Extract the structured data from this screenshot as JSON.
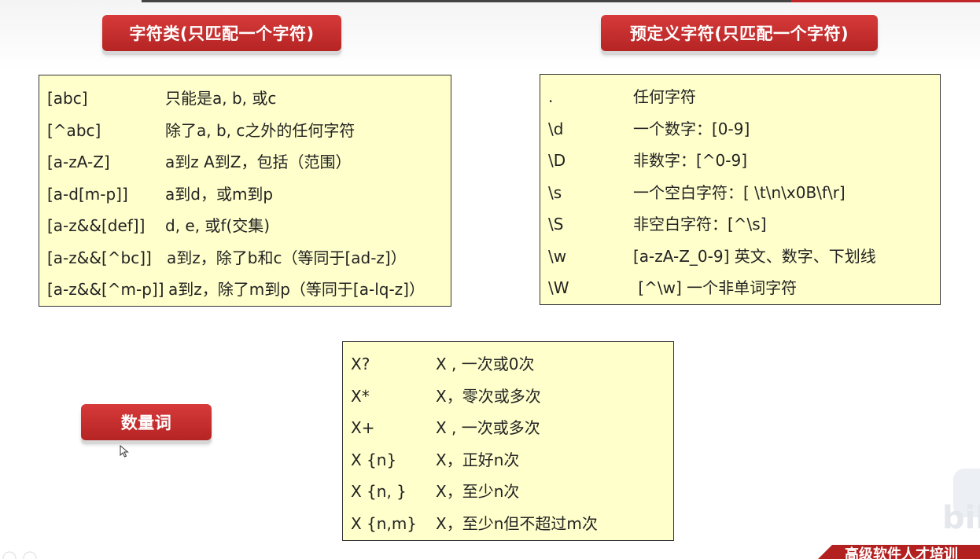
{
  "badges": {
    "char_class": "字符类(只匹配一个字符)",
    "predefined": "预定义字符(只匹配一个字符)",
    "quantifier": "数量词"
  },
  "char_class_rows": [
    {
      "k": "[abc]",
      "v": "只能是a, b, 或c"
    },
    {
      "k": "[^abc]",
      "v": "除了a, b, c之外的任何字符"
    },
    {
      "k": "[a-zA-Z]",
      "v": "a到z A到Z，包括（范围）"
    },
    {
      "k": "[a-d[m-p]]",
      "v": "a到d，或m到p"
    },
    {
      "k": "[a-z&&[def]]",
      "v": "d, e, 或f(交集)"
    },
    {
      "k": "[a-z&&[^bc]]",
      "v": "a到z，除了b和c（等同于[ad-z]）"
    },
    {
      "k": "[a-z&&[^m-p]]",
      "v": "a到z，除了m到p（等同于[a-lq-z]）"
    }
  ],
  "predef_rows": [
    {
      "k": ".",
      "v": "任何字符"
    },
    {
      "k": "\\d",
      "v": "一个数字：[0-9]"
    },
    {
      "k": "\\D",
      "v": "非数字：[^0-9]"
    },
    {
      "k": "\\s",
      "v": "一个空白字符：[ \\t\\n\\x0B\\f\\r]"
    },
    {
      "k": "\\S",
      "v": "非空白字符：[^\\s]"
    },
    {
      "k": "\\w",
      "v": "[a-zA-Z_0-9] 英文、数字、下划线"
    },
    {
      "k": "\\W",
      "v": " [^\\w] 一个非单词字符"
    }
  ],
  "quant_rows": [
    {
      "k": "X?",
      "v": "X , 一次或0次"
    },
    {
      "k": "X*",
      "v": "X，零次或多次"
    },
    {
      "k": "X+",
      "v": "X , 一次或多次"
    },
    {
      "k": "X {n}",
      "v": "X，正好n次"
    },
    {
      "k": "X {n, }",
      "v": "X，至少n次"
    },
    {
      "k": "X {n,m}",
      "v": "X，至少n但不超过m次"
    }
  ],
  "footer": {
    "text": "高级软件人才培训"
  },
  "watermark": {
    "text": "bili"
  },
  "colors": {
    "badge": "#c62d2d",
    "box": "#ffffcc",
    "accent": "#b32020"
  }
}
